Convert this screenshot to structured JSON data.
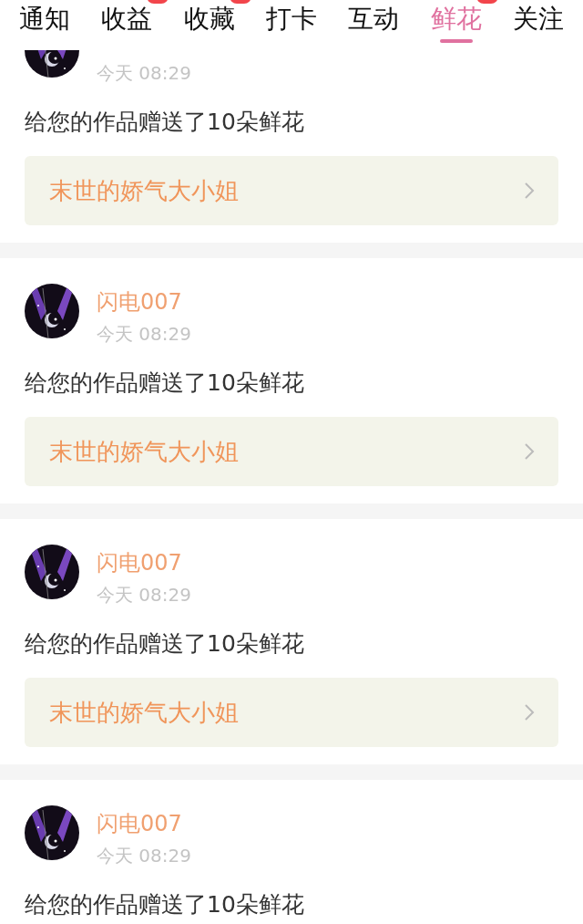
{
  "tabs": [
    {
      "label": "通知",
      "selected": false,
      "badge": false
    },
    {
      "label": "收益",
      "selected": false,
      "badge": true
    },
    {
      "label": "收藏",
      "selected": false,
      "badge": true
    },
    {
      "label": "打卡",
      "selected": false,
      "badge": false
    },
    {
      "label": "互动",
      "selected": false,
      "badge": false
    },
    {
      "label": "鲜花",
      "selected": true,
      "badge": true
    },
    {
      "label": "关注",
      "selected": false,
      "badge": false
    }
  ],
  "messages": [
    {
      "time": "今天 08:29",
      "text": "给您的作品赠送了10朵鲜花",
      "work": "末世的娇气大小姐"
    },
    {
      "name": "闪电007",
      "time": "今天 08:29",
      "text": "给您的作品赠送了10朵鲜花",
      "work": "末世的娇气大小姐"
    },
    {
      "name": "闪电007",
      "time": "今天 08:29",
      "text": "给您的作品赠送了10朵鲜花",
      "work": "末世的娇气大小姐"
    },
    {
      "name": "闪电007",
      "time": "今天 08:29",
      "text": "给您的作品赠送了10朵鲜花"
    }
  ]
}
